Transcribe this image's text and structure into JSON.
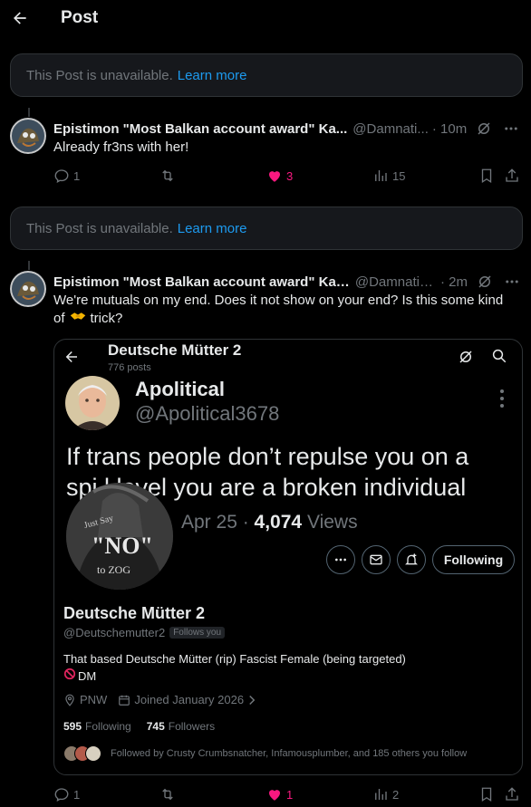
{
  "header": {
    "title": "Post"
  },
  "unavailable": {
    "text": "This Post is unavailable.",
    "link": "Learn more"
  },
  "post1": {
    "name": "Epistimon \"Most Balkan account award\" Ka...",
    "handle": "@Damnati...",
    "time": "· 10m",
    "text": "Already fr3ns with her!",
    "replies": "1",
    "reposts": "",
    "likes": "3",
    "views": "15"
  },
  "post2": {
    "name": "Epistimon \"Most Balkan account award\" Kap...",
    "handle": "@Damnatio...",
    "time": "· 2m",
    "text_line1": "We're mutuals on my end. Does it not show on your end? Is this some kind",
    "text_line2_prefix": "of",
    "text_line2_suffix": "trick?",
    "replies": "1",
    "likes": "1",
    "views": "2"
  },
  "embed": {
    "top_name": "Deutsche Mütter 2",
    "top_posts": "776 posts",
    "qt_name": "Apolitical",
    "qt_handle": "@Apolitical3678",
    "qt_text_line1": "If trans people don’t repulse you on a",
    "qt_text_line2": "spi      l level you are a broken individual",
    "qt_date": "Apr 25 ·",
    "qt_views_count": "4,074",
    "qt_views_label": "Views",
    "overlay_text_top": "Just Say",
    "overlay_text_no": "\"NO\"",
    "overlay_text_bottom": "to ZOG",
    "following_label": "Following",
    "profile": {
      "name": "Deutsche Mütter 2",
      "handle": "@Deutschemutter2",
      "follows_you": "Follows you",
      "bio_line1": "That based Deutsche Mütter (rip)  Fascist Female (being targeted)",
      "bio_line2": "DM",
      "location": "PNW",
      "joined": "Joined January 2026",
      "following_count": "595",
      "following_label": "Following",
      "followers_count": "745",
      "followers_label": "Followers",
      "followed_by": "Followed by Crusty Crumbsnatcher, Infamousplumber, and 185 others you follow"
    }
  },
  "colors": {
    "accent": "#1d9bf0",
    "like": "#f91880",
    "muted": "#71767b"
  }
}
